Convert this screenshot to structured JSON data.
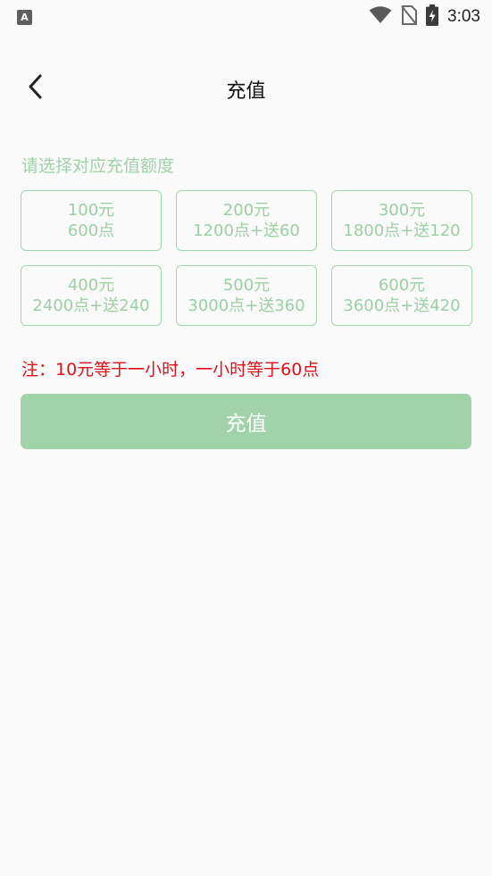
{
  "status_bar": {
    "time": "3:03",
    "notification_icon_letter": "A",
    "icons": [
      "wifi-icon",
      "no-sim-icon",
      "battery-charging-icon"
    ]
  },
  "toolbar": {
    "back_icon": "chevron-left-icon",
    "title": "充值"
  },
  "content": {
    "prompt": "请选择对应充值额度",
    "options": [
      {
        "amount": "100元",
        "points": "600点"
      },
      {
        "amount": "200元",
        "points": "1200点+送60"
      },
      {
        "amount": "300元",
        "points": "1800点+送120"
      },
      {
        "amount": "400元",
        "points": "2400点+送240"
      },
      {
        "amount": "500元",
        "points": "3000点+送360"
      },
      {
        "amount": "600元",
        "points": "3600点+送420"
      }
    ],
    "note": "注：10元等于一小时，一小时等于60点",
    "submit_label": "充值"
  },
  "colors": {
    "accent_green": "#9bcfa4",
    "button_green": "#a2d3a8",
    "note_red": "#e0101a",
    "background": "#fafafa"
  }
}
